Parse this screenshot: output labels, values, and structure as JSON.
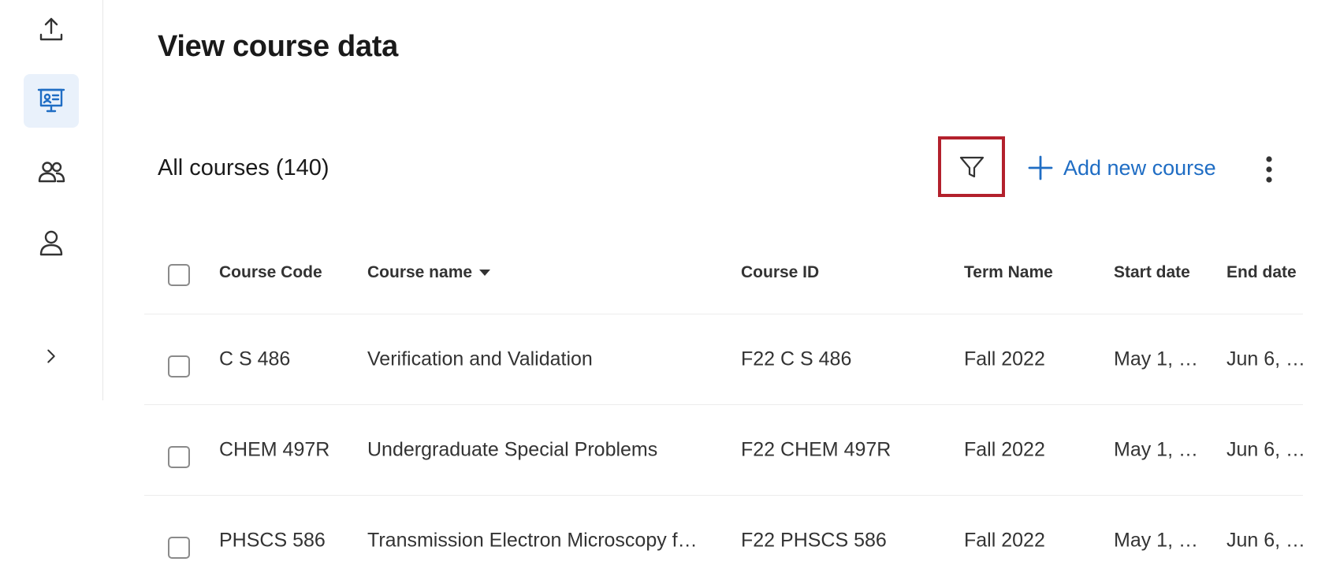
{
  "page": {
    "title": "View course data"
  },
  "toolbar": {
    "course_count_label": "All courses (140)",
    "add_course_label": "Add new course"
  },
  "colors": {
    "accent": "#1f6dc4",
    "highlight_border": "#b3212c",
    "active_nav_bg": "#e9f1fb"
  },
  "sidebar": {
    "items": [
      {
        "icon": "upload-icon"
      },
      {
        "icon": "presentation-icon",
        "active": true
      },
      {
        "icon": "users-icon"
      },
      {
        "icon": "user-icon"
      },
      {
        "icon": "chevron-right-icon"
      }
    ]
  },
  "table": {
    "columns": {
      "code": "Course Code",
      "name": "Course name",
      "id": "Course ID",
      "term": "Term Name",
      "start": "Start date",
      "end": "End date"
    },
    "rows": [
      {
        "code": "C S 486",
        "name": "Verification and Validation",
        "id": "F22 C S 486",
        "term": "Fall 2022",
        "start": "May 1, …",
        "end": "Jun 6, …"
      },
      {
        "code": "CHEM 497R",
        "name": "Undergraduate Special Problems",
        "id": "F22 CHEM 497R",
        "term": "Fall 2022",
        "start": "May 1, …",
        "end": "Jun 6, …"
      },
      {
        "code": "PHSCS 586",
        "name": "Transmission Electron Microscopy f…",
        "id": "F22 PHSCS 586",
        "term": "Fall 2022",
        "start": "May 1, …",
        "end": "Jun 6, …"
      }
    ]
  }
}
